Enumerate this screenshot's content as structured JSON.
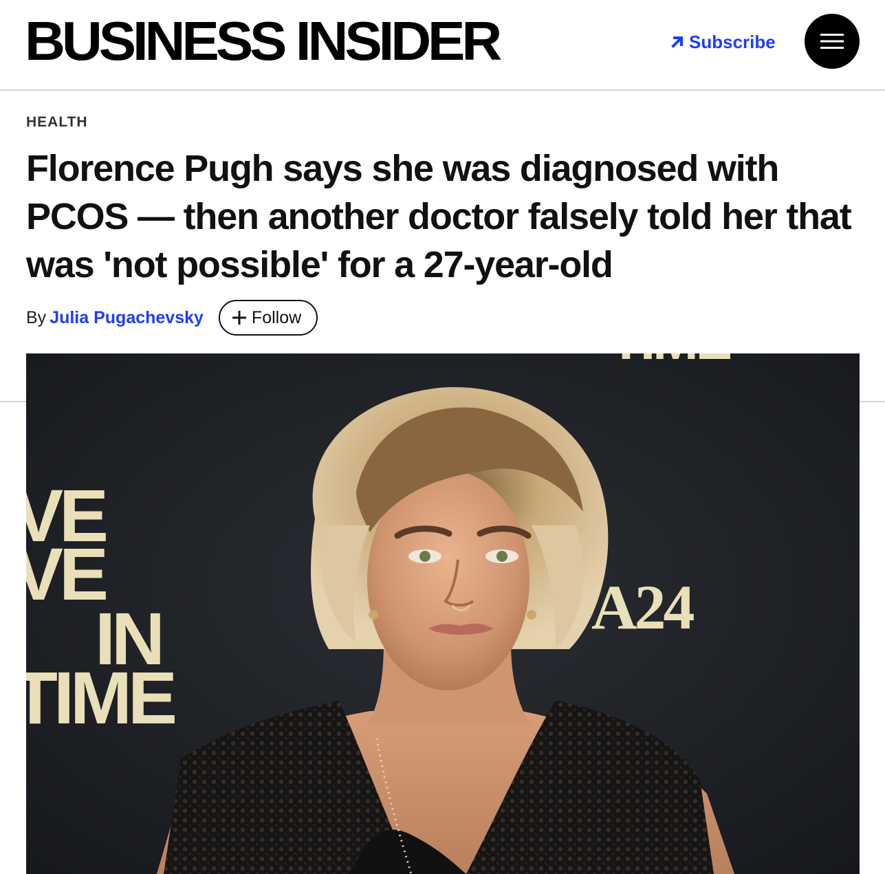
{
  "header": {
    "logo_text": "BUSINESS INSIDER",
    "subscribe_label": "Subscribe",
    "subscribe_icon": "arrow-up-right-icon",
    "menu_icon": "hamburger-menu-icon"
  },
  "article": {
    "category": "HEALTH",
    "headline": "Florence Pugh says she was diagnosed with PCOS — then another doctor falsely told her that was 'not possible' for a 27-year-old",
    "byline": {
      "by_label": "By",
      "author": "Julia Pugachevsky",
      "follow_label": "Follow",
      "follow_icon": "plus-icon"
    }
  },
  "hero_image": {
    "backdrop_text": {
      "left_lines": [
        "VE",
        "VE",
        "IN",
        "TIME"
      ],
      "top_fragment": "TIME",
      "brand": "A24"
    }
  },
  "colors": {
    "accent_link": "#1e3ef5",
    "divider": "#d6d6d6",
    "backdrop": "#1d1f24",
    "backdrop_text": "#e9dfb8"
  }
}
